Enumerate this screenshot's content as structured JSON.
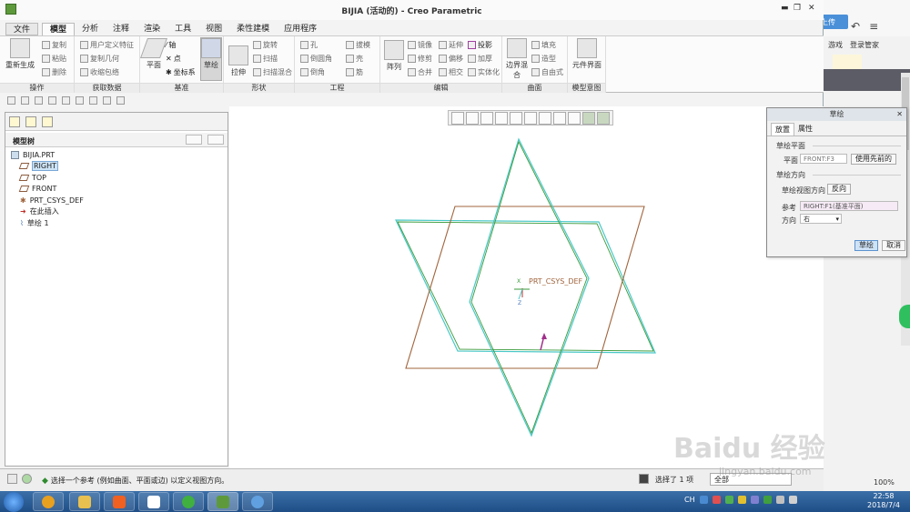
{
  "window": {
    "title": "BIJIA (活动的) - Creo Parametric"
  },
  "tabs": {
    "file": "文件",
    "items": [
      "模型",
      "分析",
      "注释",
      "渲染",
      "工具",
      "视图",
      "柔性建模",
      "应用程序"
    ]
  },
  "ribbon": {
    "ops": {
      "label": "操作",
      "regen": "重新生成",
      "copy": "复制",
      "paste": "粘贴",
      "delete": "删除"
    },
    "getdata": {
      "label": "获取数据",
      "udf": "用户定义特征",
      "copygeom": "复制几何",
      "shrink": "收缩包络"
    },
    "datum": {
      "label": "基准",
      "plane": "平面",
      "axis": "轴",
      "point": "点",
      "csys": "坐标系",
      "sketch": "草绘"
    },
    "shape": {
      "label": "形状",
      "extrude": "拉伸",
      "revolve": "旋转",
      "sweep": "扫描",
      "blend": "扫描混合"
    },
    "eng": {
      "label": "工程",
      "hole": "孔",
      "round": "倒圆角",
      "chamfer": "倒角",
      "draft": "拔模",
      "shell": "壳",
      "rib": "筋"
    },
    "edit": {
      "label": "编辑",
      "pattern": "阵列",
      "mirror": "镜像",
      "extend": "延伸",
      "project": "投影",
      "trim": "修剪",
      "offset": "偏移",
      "thicken": "加厚",
      "merge": "合并",
      "intersect": "相交",
      "solidify": "实体化"
    },
    "surface": {
      "label": "曲面",
      "freestyle": "边界混合",
      "fill": "填充",
      "style": "造型",
      "freeform": "自由式"
    },
    "intent": {
      "label": "模型意图",
      "ui": "元件界面"
    }
  },
  "model_tree": {
    "header": "模型树",
    "root": "BIJIA.PRT",
    "items": [
      "RIGHT",
      "TOP",
      "FRONT",
      "PRT_CSYS_DEF",
      "在此插入",
      "草绘 1"
    ]
  },
  "graphics": {
    "csys_label": "PRT_CSYS_DEF",
    "axis_x": "X",
    "axis_z": "Z"
  },
  "dialog": {
    "title": "草绘",
    "tab_place": "放置",
    "tab_props": "属性",
    "sec_plane": "草绘平面",
    "plane_label": "平面",
    "plane_value": "FRONT:F3",
    "use_prev": "使用先前的",
    "sec_orient": "草绘方向",
    "view_dir": "草绘视图方向",
    "flip": "反向",
    "ref_label": "参考",
    "ref_value": "RIGHT:F1(基准平面)",
    "dir_label": "方向",
    "dir_value": "右",
    "ok": "草绘",
    "cancel": "取消"
  },
  "status": {
    "message": "选择一个参考 (例如曲面、平面或边) 以定义视图方向。",
    "selected": "选择了 1 项",
    "filter": "全部"
  },
  "browser": {
    "upload": "拍摄上传",
    "game": "游戏",
    "login": "登录管家",
    "zoom": "100%"
  },
  "taskbar": {
    "lang": "CH",
    "time": "22:58",
    "date": "2018/7/4"
  },
  "watermark": {
    "brand": "Baidu 经验",
    "url": "jingyan.baidu.com"
  },
  "colors": {
    "sketch_green": "#3a9a3a",
    "plane_cyan": "#4ac8c8",
    "plane_brown": "#a0643c",
    "accent": "#4a90d9"
  }
}
